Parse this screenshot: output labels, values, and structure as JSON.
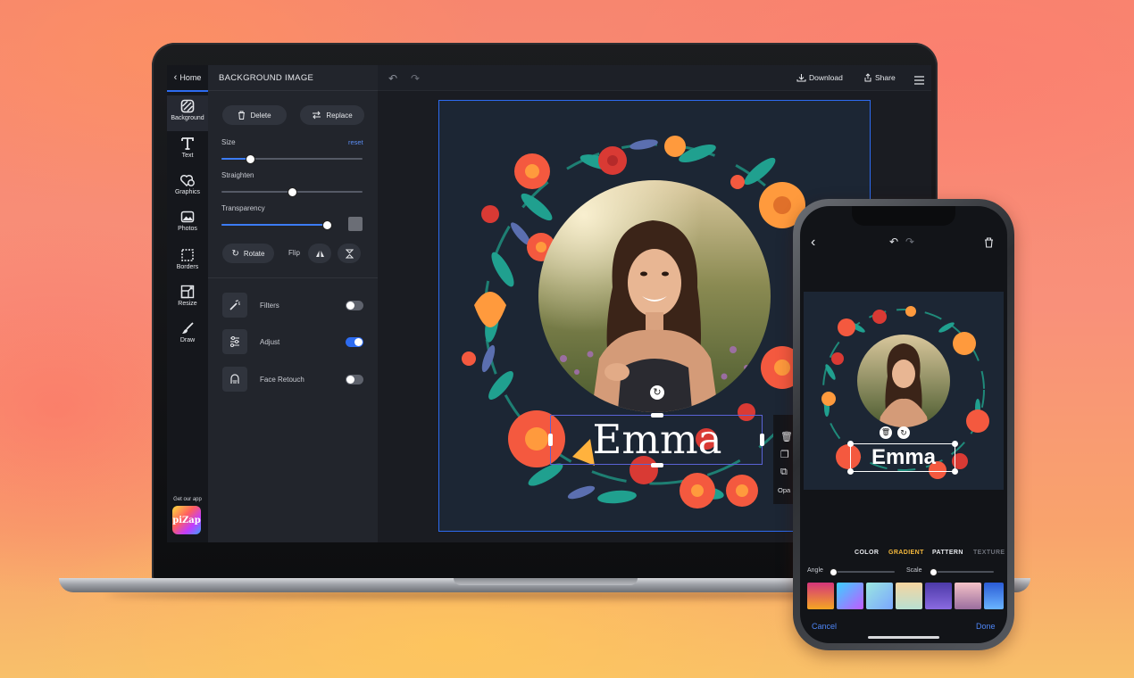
{
  "laptop": {
    "rail": {
      "home_label": "Home",
      "items": [
        {
          "label": "Background",
          "icon": "background-icon"
        },
        {
          "label": "Text",
          "icon": "text-icon"
        },
        {
          "label": "Graphics",
          "icon": "graphics-icon"
        },
        {
          "label": "Photos",
          "icon": "photos-icon"
        },
        {
          "label": "Borders",
          "icon": "borders-icon"
        },
        {
          "label": "Resize",
          "icon": "resize-icon"
        },
        {
          "label": "Draw",
          "icon": "draw-icon"
        }
      ],
      "get_app_label": "Get our app",
      "app_logo_text": "piZap"
    },
    "panel": {
      "title": "BACKGROUND IMAGE",
      "delete_label": "Delete",
      "replace_label": "Replace",
      "size_label": "Size",
      "reset_label": "reset",
      "size_value": 0.2,
      "straighten_label": "Straighten",
      "straighten_value": 0.5,
      "transparency_label": "Transparency",
      "transparency_value": 0.95,
      "rotate_label": "Rotate",
      "flip_label": "Flip",
      "rows": [
        {
          "label": "Filters",
          "enabled": false,
          "icon": "magic-wand-icon"
        },
        {
          "label": "Adjust",
          "enabled": true,
          "icon": "sliders-icon"
        },
        {
          "label": "Face Retouch",
          "enabled": false,
          "icon": "face-icon"
        }
      ]
    },
    "topbar": {
      "download_label": "Download",
      "share_label": "Share"
    },
    "canvas": {
      "text": "Emma",
      "side_toolbar_label": "Opa"
    }
  },
  "phone": {
    "canvas_text": "Emma",
    "tabs": [
      "COLOR",
      "GRADIENT",
      "PATTERN",
      "TEXTURE"
    ],
    "active_tab": "GRADIENT",
    "angle_label": "Angle",
    "scale_label": "Scale",
    "cancel_label": "Cancel",
    "done_label": "Done"
  },
  "colors": {
    "accent": "#2d6bf0",
    "active_tab": "#f5b93c"
  }
}
